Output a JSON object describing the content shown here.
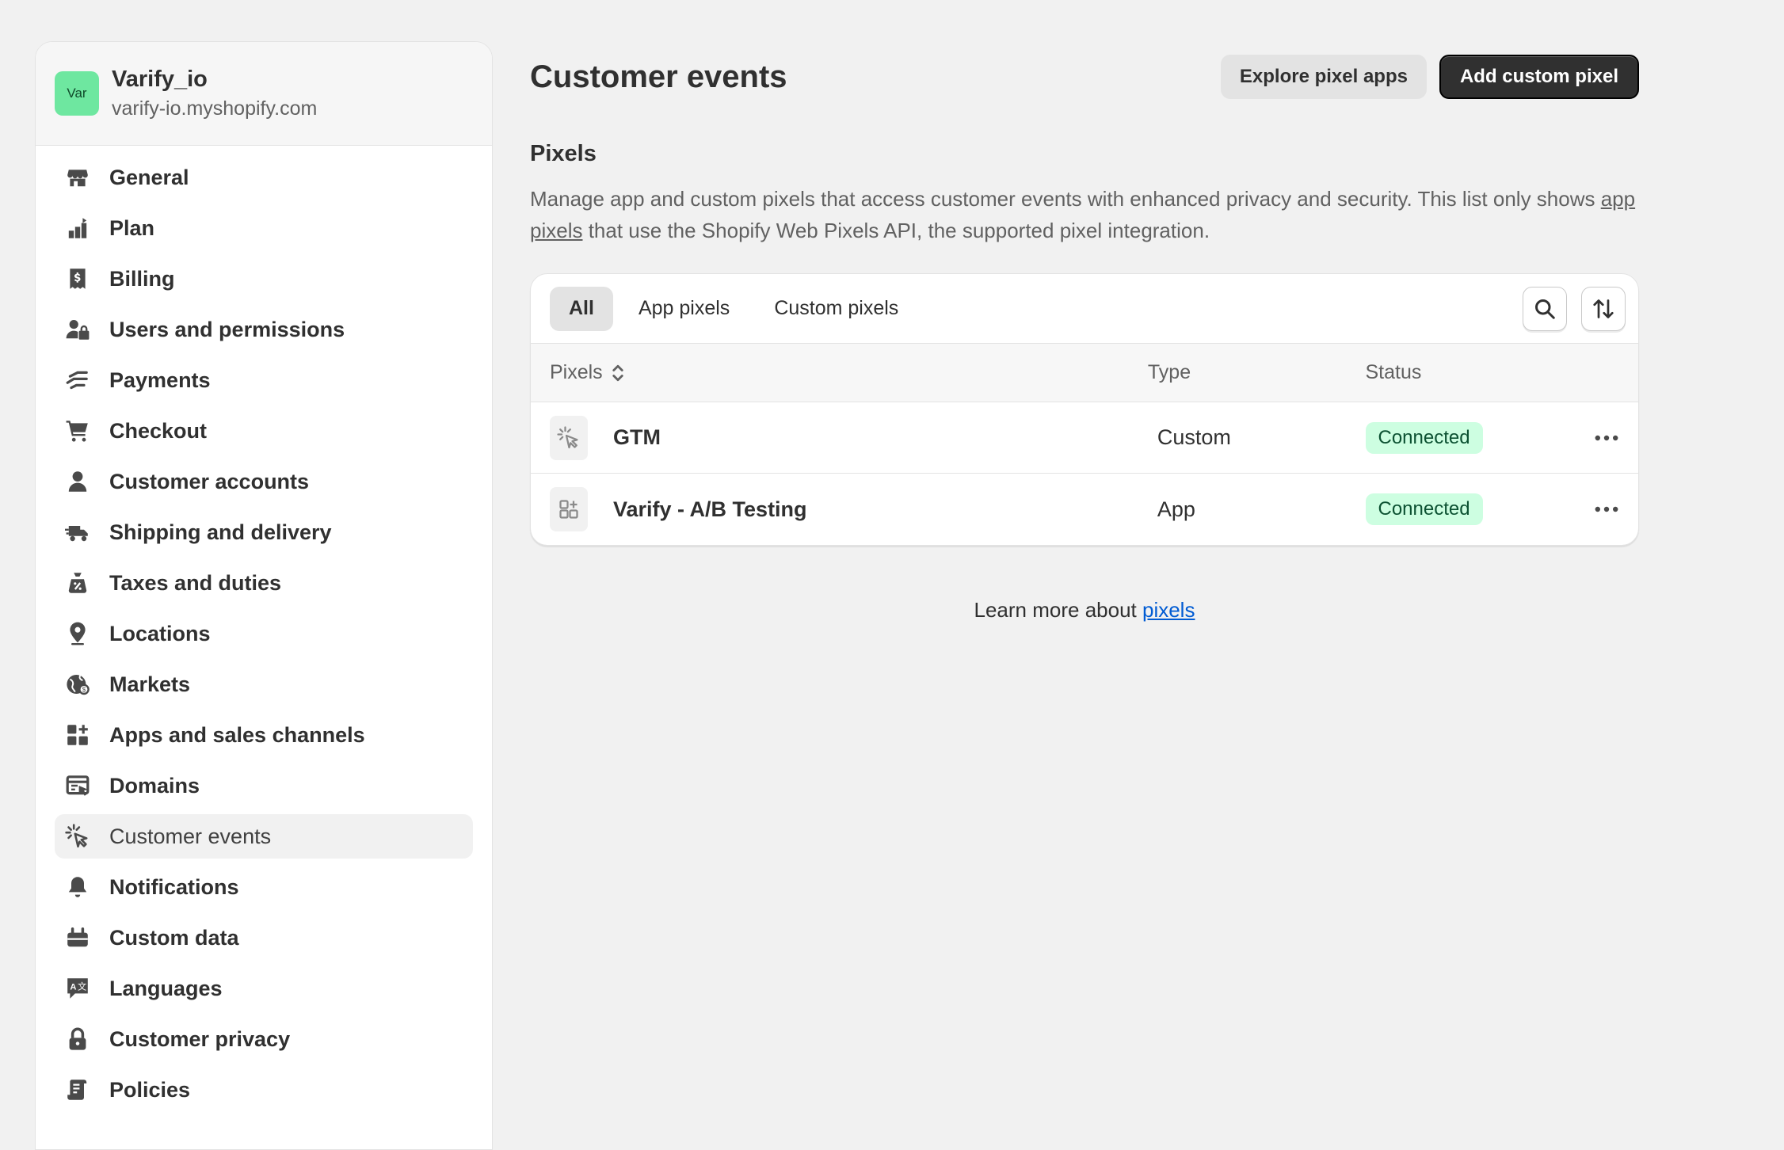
{
  "store": {
    "avatar_text": "Var",
    "avatar_color": "#6ee7a0",
    "name": "Varify_io",
    "domain": "varify-io.myshopify.com"
  },
  "sidebar": {
    "items": [
      {
        "label": "General",
        "icon": "store-icon"
      },
      {
        "label": "Plan",
        "icon": "plan-icon"
      },
      {
        "label": "Billing",
        "icon": "billing-icon"
      },
      {
        "label": "Users and permissions",
        "icon": "users-icon"
      },
      {
        "label": "Payments",
        "icon": "payments-icon"
      },
      {
        "label": "Checkout",
        "icon": "cart-icon"
      },
      {
        "label": "Customer accounts",
        "icon": "person-icon"
      },
      {
        "label": "Shipping and delivery",
        "icon": "truck-icon"
      },
      {
        "label": "Taxes and duties",
        "icon": "tax-icon"
      },
      {
        "label": "Locations",
        "icon": "location-pin-icon"
      },
      {
        "label": "Markets",
        "icon": "globe-icon"
      },
      {
        "label": "Apps and sales channels",
        "icon": "apps-icon"
      },
      {
        "label": "Domains",
        "icon": "domain-icon"
      },
      {
        "label": "Customer events",
        "icon": "cursor-click-icon",
        "active": true
      },
      {
        "label": "Notifications",
        "icon": "bell-icon"
      },
      {
        "label": "Custom data",
        "icon": "custom-data-icon"
      },
      {
        "label": "Languages",
        "icon": "language-icon"
      },
      {
        "label": "Customer privacy",
        "icon": "lock-icon"
      },
      {
        "label": "Policies",
        "icon": "policy-icon"
      }
    ]
  },
  "header": {
    "title": "Customer events",
    "explore_label": "Explore pixel apps",
    "add_label": "Add custom pixel"
  },
  "pixels_section": {
    "title": "Pixels",
    "desc_before": "Manage app and custom pixels that access customer events with enhanced privacy and security. This list only shows ",
    "desc_link": "app pixels",
    "desc_after": " that use the Shopify Web Pixels API, the supported pixel integration."
  },
  "tabs": [
    {
      "label": "All",
      "active": true
    },
    {
      "label": "App pixels"
    },
    {
      "label": "Custom pixels"
    }
  ],
  "table": {
    "headers": {
      "pixels": "Pixels",
      "type": "Type",
      "status": "Status"
    },
    "rows": [
      {
        "name": "GTM",
        "type": "Custom",
        "status": "Connected",
        "icon": "cursor-click-icon"
      },
      {
        "name": "Varify - A/B Testing",
        "type": "App",
        "status": "Connected",
        "icon": "app-grid-icon"
      }
    ]
  },
  "footer": {
    "learn_text": "Learn more about ",
    "learn_link": "pixels"
  },
  "colors": {
    "background": "#f1f1f1",
    "badge_bg": "#cdfee1",
    "badge_text": "#0c5132",
    "link": "#005bd3",
    "primary_button": "#303030"
  }
}
